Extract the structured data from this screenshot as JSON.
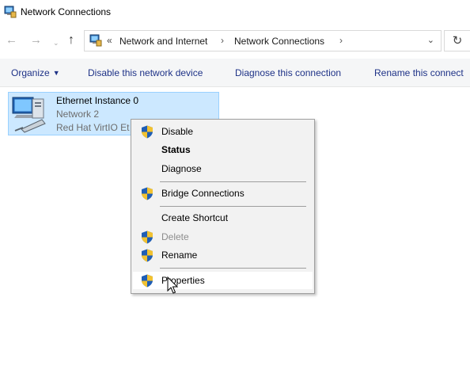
{
  "window": {
    "title": "Network Connections",
    "icon": "network-connections-icon"
  },
  "navigation": {
    "back_icon": "←",
    "forward_icon": "→",
    "recent_icon": "⌄",
    "up_icon": "↑",
    "address": {
      "overflow": "«",
      "separator": "›",
      "breadcrumbs": [
        "Network and Internet",
        "Network Connections"
      ],
      "dropdown_icon": "⌄"
    },
    "refresh_icon": "↻"
  },
  "command_bar": {
    "organize": "Organize",
    "organize_caret": "▼",
    "disable": "Disable this network device",
    "diagnose": "Diagnose this connection",
    "rename": "Rename this connect"
  },
  "connection": {
    "name": "Ethernet Instance 0",
    "network": "Network 2",
    "adapter": "Red Hat VirtIO Et"
  },
  "context_menu": {
    "items": [
      {
        "label": "Disable",
        "shield": true,
        "bold": false,
        "disabled": false
      },
      {
        "label": "Status",
        "shield": false,
        "bold": true,
        "disabled": false
      },
      {
        "label": "Diagnose",
        "shield": false,
        "bold": false,
        "disabled": false
      },
      {
        "label": "Bridge Connections",
        "shield": true,
        "bold": false,
        "disabled": false
      },
      {
        "label": "Create Shortcut",
        "shield": false,
        "bold": false,
        "disabled": false
      },
      {
        "label": "Delete",
        "shield": true,
        "bold": false,
        "disabled": true
      },
      {
        "label": "Rename",
        "shield": true,
        "bold": false,
        "disabled": false
      },
      {
        "label": "Properties",
        "shield": true,
        "bold": false,
        "disabled": false,
        "hovered": true
      }
    ]
  },
  "colors": {
    "link": "#1e3287",
    "selection_bg": "#cce8ff",
    "selection_border": "#99d1ff",
    "menu_bg": "#f2f2f2",
    "disabled_text": "#8d8d8d"
  }
}
